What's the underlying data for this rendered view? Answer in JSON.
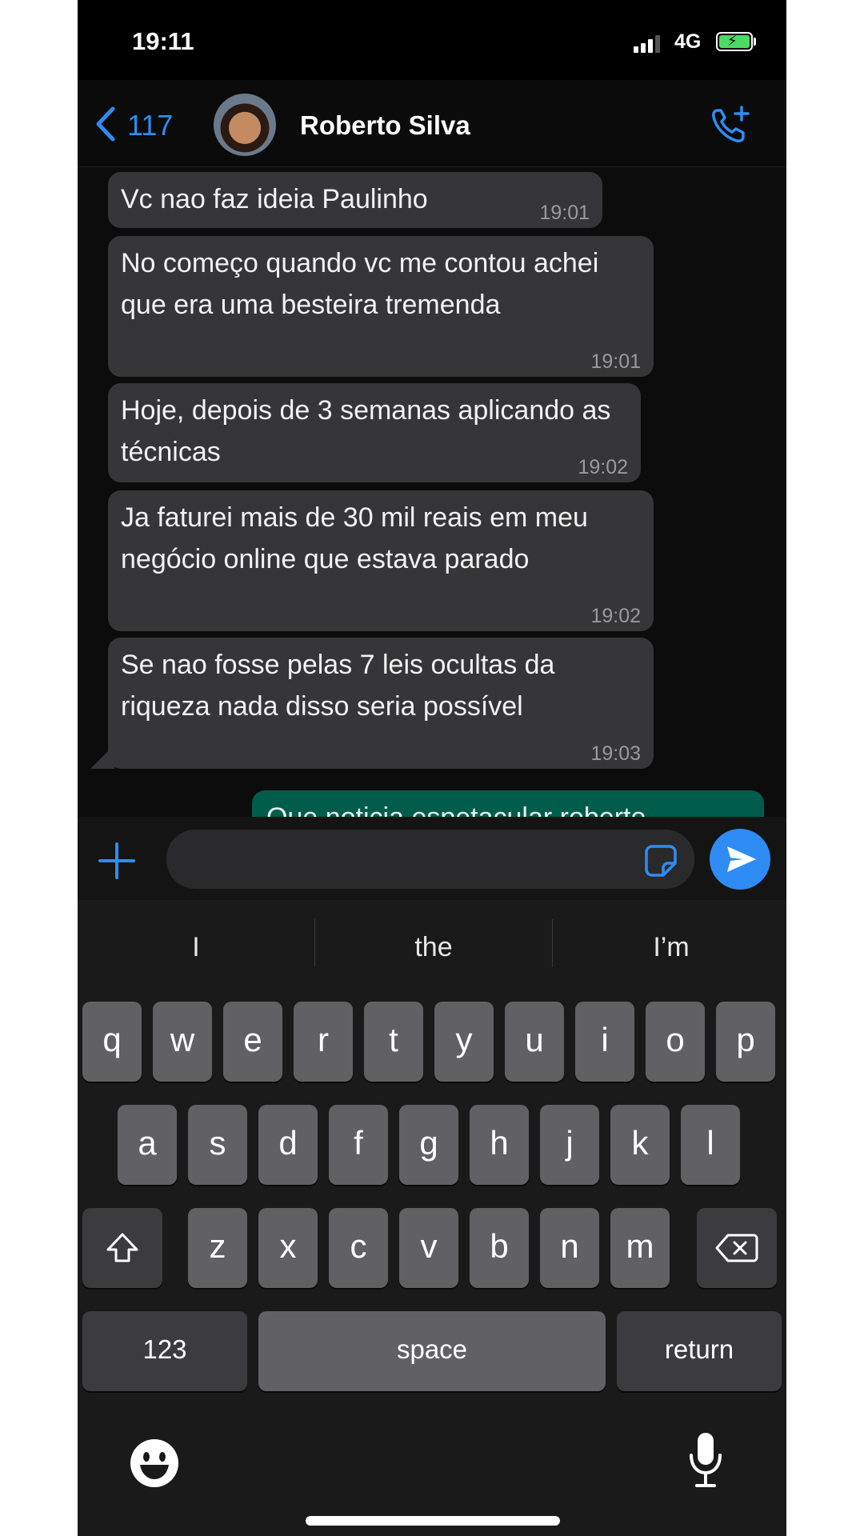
{
  "status_bar": {
    "time": "19:11",
    "network": "4G"
  },
  "header": {
    "back_count": "117",
    "contact_name": "Roberto Silva"
  },
  "messages": [
    {
      "text": "Vc nao faz ideia Paulinho",
      "time": "19:01"
    },
    {
      "text": "No começo quando vc me contou achei que era uma besteira tremenda",
      "time": "19:01"
    },
    {
      "text": "Hoje, depois de 3 semanas aplicando as técnicas",
      "time": "19:02"
    },
    {
      "text": "Ja faturei mais de 30 mil reais em meu negócio online que estava parado",
      "time": "19:02"
    },
    {
      "text": "Se nao fosse pelas 7 leis ocultas da riqueza nada disso seria possível",
      "time": "19:03"
    }
  ],
  "outgoing_partial": {
    "text": "Que noticia espetacular roberto"
  },
  "input": {
    "value": ""
  },
  "keyboard": {
    "suggestions": [
      "I",
      "the",
      "I’m"
    ],
    "row1": [
      "q",
      "w",
      "e",
      "r",
      "t",
      "y",
      "u",
      "i",
      "o",
      "p"
    ],
    "row2": [
      "a",
      "s",
      "d",
      "f",
      "g",
      "h",
      "j",
      "k",
      "l"
    ],
    "row3": [
      "z",
      "x",
      "c",
      "v",
      "b",
      "n",
      "m"
    ],
    "numbers_label": "123",
    "space_label": "space",
    "return_label": "return"
  },
  "colors": {
    "accent": "#2f8cf5",
    "incoming_bubble": "#363638",
    "outgoing_bubble": "#005c4b",
    "background": "#000000"
  },
  "icons": [
    "back-chevron-icon",
    "avatar",
    "add-call-icon",
    "plus-icon",
    "sticker-icon",
    "send-icon",
    "shift-icon",
    "backspace-icon",
    "emoji-icon",
    "microphone-icon"
  ]
}
